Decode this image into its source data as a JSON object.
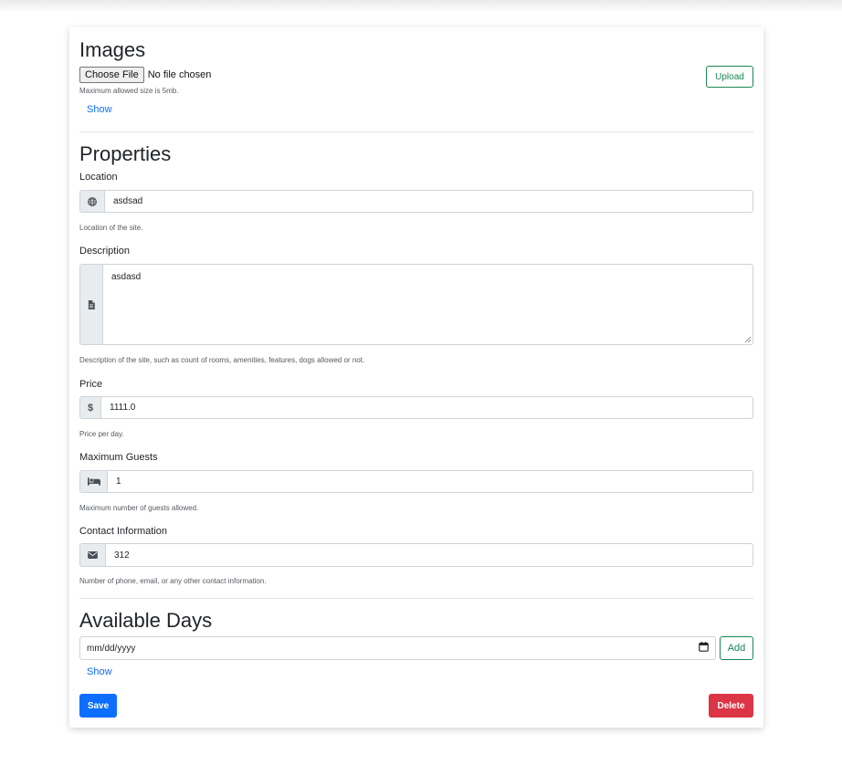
{
  "images": {
    "heading": "Images",
    "choose_file_label": "Choose File",
    "no_file_text": "No file chosen",
    "help": "Maximum allowed size is 5mb.",
    "upload_label": "Upload",
    "show_label": "Show"
  },
  "properties": {
    "heading": "Properties",
    "location": {
      "label": "Location",
      "icon": "globe-icon",
      "value": "asdsad",
      "help": "Location of the site."
    },
    "description": {
      "label": "Description",
      "icon": "document-icon",
      "value": "asdasd",
      "help": "Description of the site, such as count of rooms, amenities, features, dogs allowed or not."
    },
    "price": {
      "label": "Price",
      "icon": "dollar-icon",
      "icon_glyph": "$",
      "value": "1111.0",
      "help": "Price per day."
    },
    "max_guests": {
      "label": "Maximum Guests",
      "icon": "bed-icon",
      "value": "1",
      "help": "Maximum number of guests allowed."
    },
    "contact": {
      "label": "Contact Information",
      "icon": "envelope-icon",
      "value": "312",
      "help": "Number of phone, email, or any other contact information."
    }
  },
  "available_days": {
    "heading": "Available Days",
    "date_placeholder": "mm/dd/yyyy",
    "add_label": "Add",
    "show_label": "Show"
  },
  "actions": {
    "save_label": "Save",
    "delete_label": "Delete"
  },
  "colors": {
    "primary": "#0d6efd",
    "success": "#198754",
    "danger": "#dc3545"
  }
}
